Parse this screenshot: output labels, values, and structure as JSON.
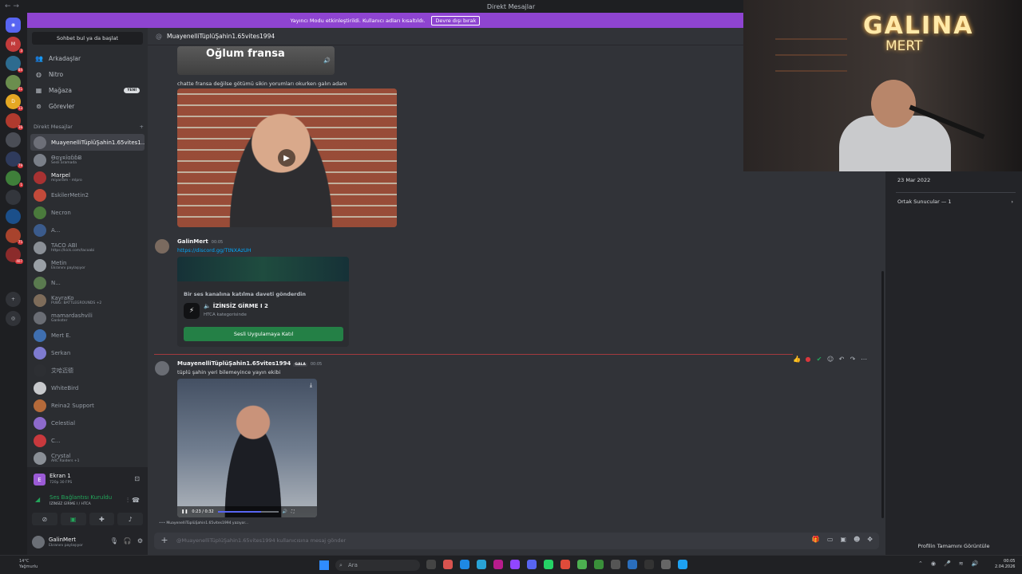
{
  "window": {
    "title": "Direkt Mesajlar"
  },
  "notice": {
    "text": "Yayıncı Modu etkinleştirildi. Kullanıcı adları kısaltıldı.",
    "button": "Devre dışı bırak"
  },
  "guilds": [
    {
      "label": "M",
      "color": "#c23b3b",
      "badge": "3"
    },
    {
      "label": "",
      "color": "#2d6b8f",
      "badge": "84"
    },
    {
      "label": "",
      "color": "#6b8e4e",
      "badge": "41"
    },
    {
      "label": "D",
      "color": "#e5a823",
      "badge": "13"
    },
    {
      "label": "",
      "color": "#b03a2e",
      "badge": "16"
    },
    {
      "label": "",
      "color": "#4a4d55",
      "badge": ""
    },
    {
      "label": "",
      "color": "#2f3b5c",
      "badge": "79"
    },
    {
      "label": "",
      "color": "#3f7f3a",
      "badge": "1"
    },
    {
      "label": "",
      "color": "#33363c",
      "badge": ""
    },
    {
      "label": "",
      "color": "#1b4f8a",
      "badge": ""
    },
    {
      "label": "",
      "color": "#a8432d",
      "badge": "75"
    },
    {
      "label": "",
      "color": "#8b2b2b",
      "badge": "407"
    }
  ],
  "sidebar": {
    "search_placeholder": "Sohbet bul ya da başlat",
    "nav": [
      {
        "label": "Arkadaşlar",
        "icon": "friends-icon"
      },
      {
        "label": "Nitro",
        "icon": "nitro-icon"
      },
      {
        "label": "Mağaza",
        "icon": "shop-icon",
        "badge": "YENİ"
      },
      {
        "label": "Görevler",
        "icon": "quests-icon"
      }
    ],
    "dm_header": "Direkt Mesajlar",
    "dms": [
      {
        "name": "MuayenelliTüplüŞahin1.65vites1...",
        "status": "",
        "color": "#6d6f78",
        "active": true
      },
      {
        "name": "ƟɑɣʀȋɑɓɓɃ",
        "status": "Sesli aramada",
        "color": "#7a7f88"
      },
      {
        "name": "Marpel",
        "status": "miyardım - mlpro",
        "color": "#a83232",
        "bold": true
      },
      {
        "name": "EskilerMetin2",
        "status": "",
        "color": "#c24a3a"
      },
      {
        "name": "Necron",
        "status": "",
        "color": "#4a7a3c"
      },
      {
        "name": "A...",
        "status": "",
        "color": "#3b5b8c"
      },
      {
        "name": "TACO ABİ",
        "status": "https://kick.com/tacoabi",
        "color": "#8a8f96"
      },
      {
        "name": "Metin",
        "status": "Ekranını paylaşıyor",
        "color": "#9aa0a6"
      },
      {
        "name": "N...",
        "status": "",
        "color": "#5a7a4f"
      },
      {
        "name": "KayraKo",
        "status": "PUBG: BATTLEGROUNDS +2",
        "color": "#7e6c5a"
      },
      {
        "name": "mamardashvili",
        "status": "Gankster",
        "color": "#6a6d74"
      },
      {
        "name": "Mert E.",
        "status": "",
        "color": "#3f6fb0"
      },
      {
        "name": "Serkan",
        "status": "",
        "color": "#7e7bd0"
      },
      {
        "name": "艾哈迈德",
        "status": "",
        "color": "#2d2f33"
      },
      {
        "name": "WhiteBird",
        "status": "",
        "color": "#c7c9cc"
      },
      {
        "name": "Reina2 Support",
        "status": "",
        "color": "#b56a3a"
      },
      {
        "name": "Celestial",
        "status": "",
        "color": "#8d6acb"
      },
      {
        "name": "C...",
        "status": "",
        "color": "#c8393d"
      },
      {
        "name": "Crystal",
        "status": "ARC Raiders +1",
        "color": "#8a8f96"
      }
    ]
  },
  "voice": {
    "screen_title": "Ekran 1",
    "screen_sub": "720p 30 FPS",
    "connected_label": "Ses Bağlantısı Kuruldu",
    "channel": "İZİNSİZ GİRME I / HTCA"
  },
  "user": {
    "name": "GalinMert",
    "status": "Ekranını paylaşıyor"
  },
  "chat": {
    "recipient": "MuayenelliTüplüŞahin1.65vites1994",
    "img_caption": "Oğlum fransa",
    "msg1": "chatte fransa değilse götümü sikin yorumları okurken galın adam",
    "msg2_author": "GalinMert",
    "msg2_time": "00:05",
    "msg2_link": "https://discord.gg/TtNXAzUH",
    "invite": {
      "heading": "Bir ses kanalına katılma daveti gönderdin",
      "server": "İZİNSİZ GİRME I 2",
      "category": "HTCA kategorisinde",
      "button": "Sesli Uygulamaya Katıl"
    },
    "msg3_author": "MuayenelliTüplüŞahin1.65vites1994",
    "msg3_badge": "GALA",
    "msg3_time": "00:05",
    "msg3_text": "tüplü şahin yeri bilemeyince yayın ekibi",
    "video_time": "0:23 / 0:32",
    "video_progress": 0.72,
    "typing": "MuayenelliTüplüŞahin1.65vites1994 yazıyor...",
    "composer_placeholder": "@MuayenelliTüplüŞahin1.65vites1994 kullanıcısına mesaj gönder"
  },
  "profile": {
    "member_since": "23 Mar 2022",
    "mutual_servers": "Ortak Sunucular — 1",
    "view_full": "Profilin Tamamını Görüntüle"
  },
  "stream_overlay": {
    "neon_line1": "GALINA",
    "neon_line2": "MERT"
  },
  "taskbar": {
    "weather_temp": "14°C",
    "weather_desc": "Yağmurlu",
    "search": "Ara",
    "time": "00:05",
    "date": "2.04.2026"
  }
}
